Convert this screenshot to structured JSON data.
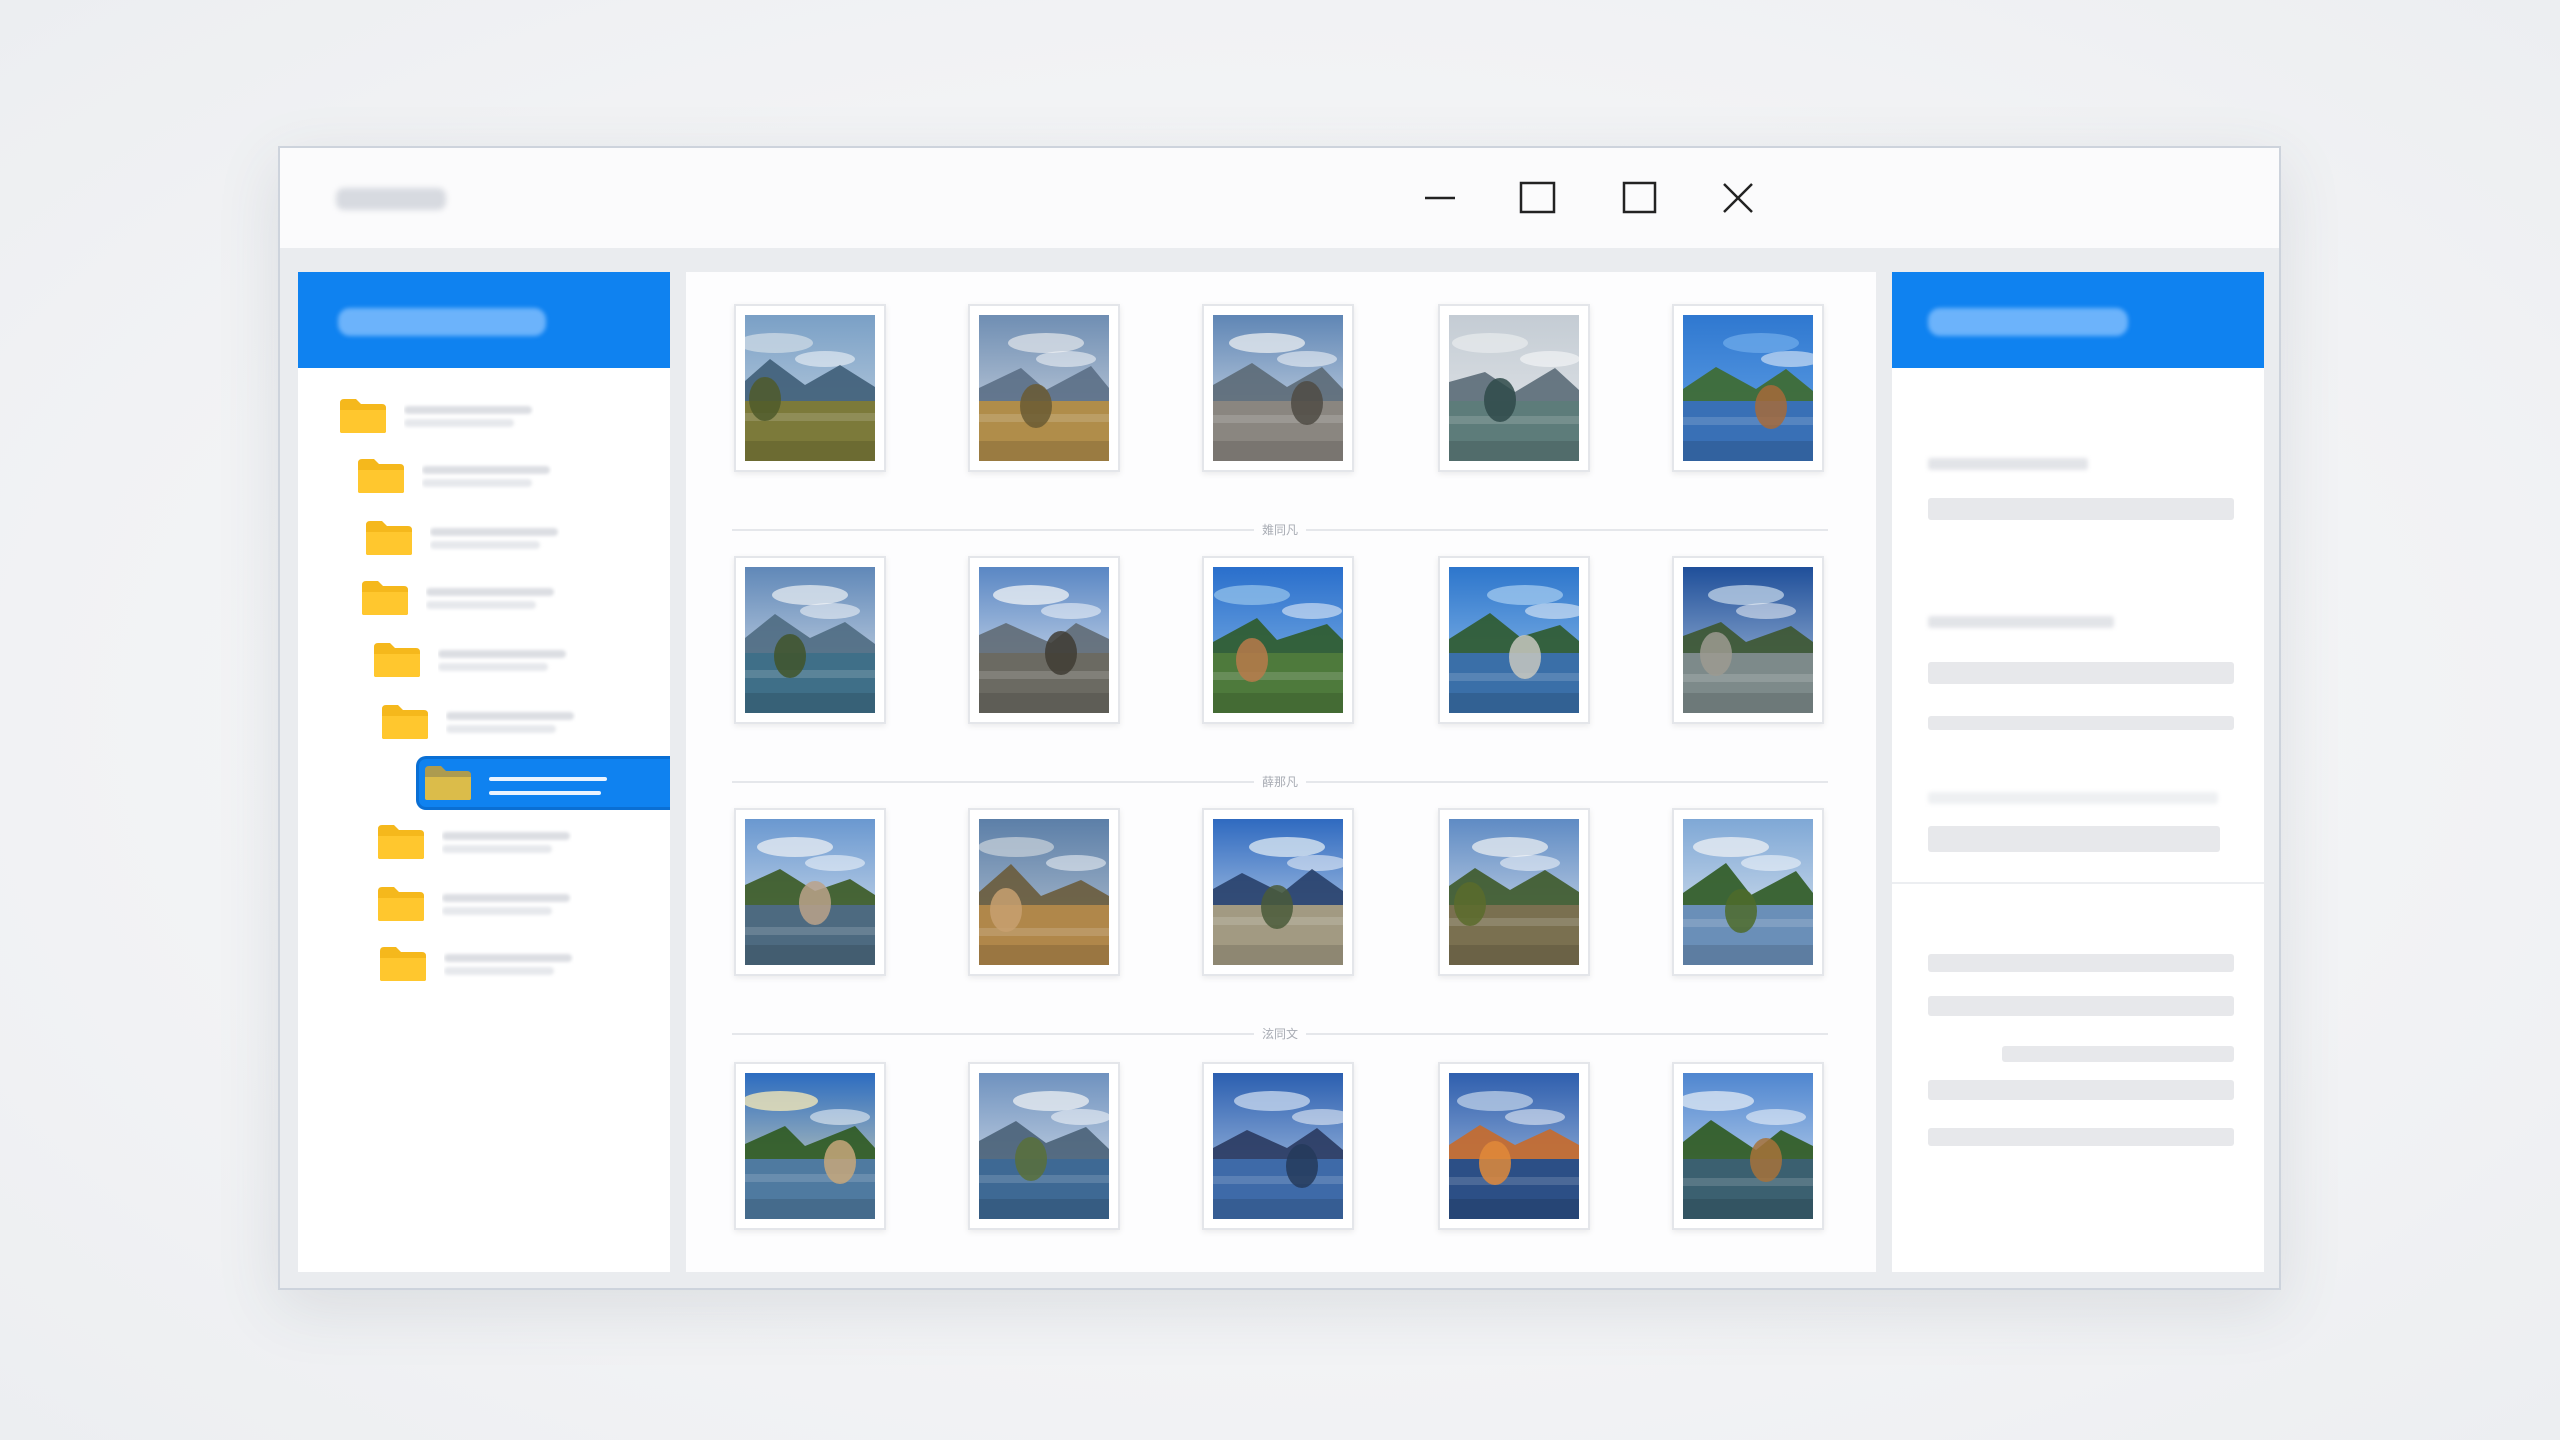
{
  "window": {
    "title": "",
    "controls": {
      "minimize": "minimize-icon",
      "maximize": "maximize-icon",
      "restore": "restore-icon",
      "close": "close-icon"
    }
  },
  "sidebar": {
    "header": "",
    "folders": [
      {
        "label": "",
        "icon": "folder-icon",
        "selected": false
      },
      {
        "label": "",
        "icon": "folder-icon",
        "selected": false
      },
      {
        "label": "",
        "icon": "folder-icon",
        "selected": false
      },
      {
        "label": "",
        "icon": "folder-icon",
        "selected": false
      },
      {
        "label": "",
        "icon": "folder-icon",
        "selected": false
      },
      {
        "label": "",
        "icon": "folder-icon",
        "selected": false
      },
      {
        "label": "",
        "icon": "folder-icon",
        "selected": true
      },
      {
        "label": "",
        "icon": "folder-icon",
        "selected": false
      },
      {
        "label": "",
        "icon": "folder-icon",
        "selected": false
      },
      {
        "label": "",
        "icon": "folder-icon",
        "selected": false
      }
    ]
  },
  "gallery": {
    "group_dividers": [
      "䧴同凡",
      "薛那凡",
      "泫同文"
    ],
    "photos": [
      {
        "scene": "lake-reeds"
      },
      {
        "scene": "mountain-peak"
      },
      {
        "scene": "cloudy-shore"
      },
      {
        "scene": "misty-field"
      },
      {
        "scene": "castle-river"
      },
      {
        "scene": "cloudy-lake"
      },
      {
        "scene": "snowy-mountains"
      },
      {
        "scene": "tower-meadow"
      },
      {
        "scene": "building-lake"
      },
      {
        "scene": "coast-clouds"
      },
      {
        "scene": "park-pond"
      },
      {
        "scene": "tower-field"
      },
      {
        "scene": "valley-mist"
      },
      {
        "scene": "tree-field"
      },
      {
        "scene": "river-trees"
      },
      {
        "scene": "palm-lakeside"
      },
      {
        "scene": "lake-clouds"
      },
      {
        "scene": "blue-lake"
      },
      {
        "scene": "sunset-reflection"
      },
      {
        "scene": "garden-pond"
      }
    ]
  },
  "properties": {
    "header": "",
    "labels": [
      "",
      "",
      "",
      "",
      "",
      ""
    ]
  },
  "colors": {
    "accent": "#0f82f0",
    "folder": "#f5b81c",
    "window_bg": "#eaecef"
  }
}
